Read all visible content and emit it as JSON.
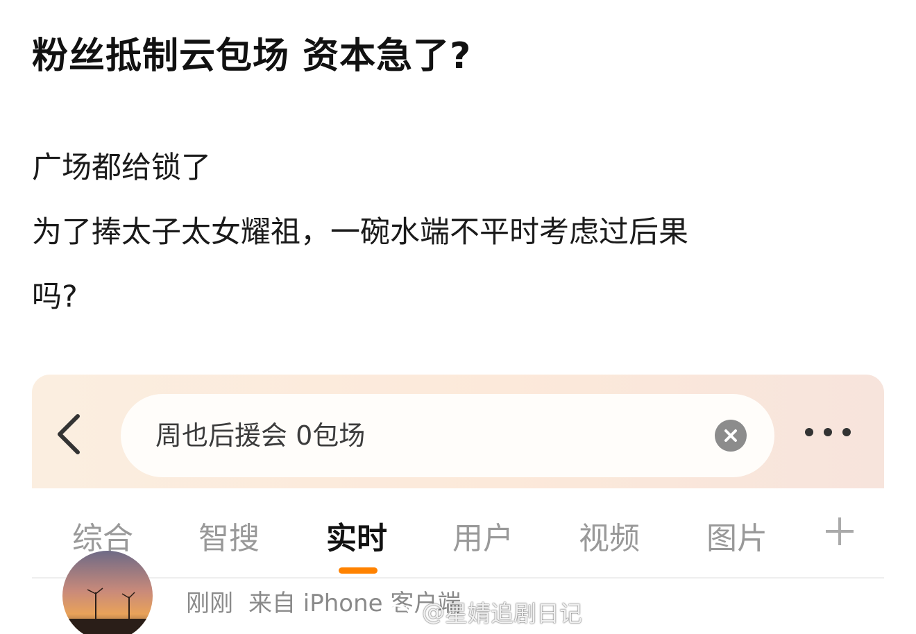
{
  "post": {
    "title": "粉丝抵制云包场 资本急了?",
    "body_lines": [
      "广场都给锁了",
      "为了捧太子太女耀祖，一碗水端不平时考虑过后果",
      "吗?"
    ]
  },
  "embedded_screenshot": {
    "search": {
      "value": "周也后援会 0包场",
      "back_icon": "chevron-left-icon",
      "clear_icon": "close-circle-icon",
      "more_icon": "more-horizontal-icon"
    },
    "tabs": [
      {
        "label": "综合"
      },
      {
        "label": "智搜"
      },
      {
        "label": "实时",
        "active": true
      },
      {
        "label": "用户"
      },
      {
        "label": "视频"
      },
      {
        "label": "图片"
      }
    ],
    "tab_add_icon": "plus-icon",
    "feed_item": {
      "time": "刚刚",
      "source": "来自 iPhone 客户端"
    }
  },
  "watermark": {
    "prefix": "@",
    "account": "星婧追剧日记"
  },
  "colors": {
    "accent": "#ff8200",
    "topbar_gradient_start": "#fbeee0",
    "topbar_gradient_end": "#f7e4dc",
    "inactive_tab": "#999999",
    "meta_text": "#8a8a8a"
  }
}
